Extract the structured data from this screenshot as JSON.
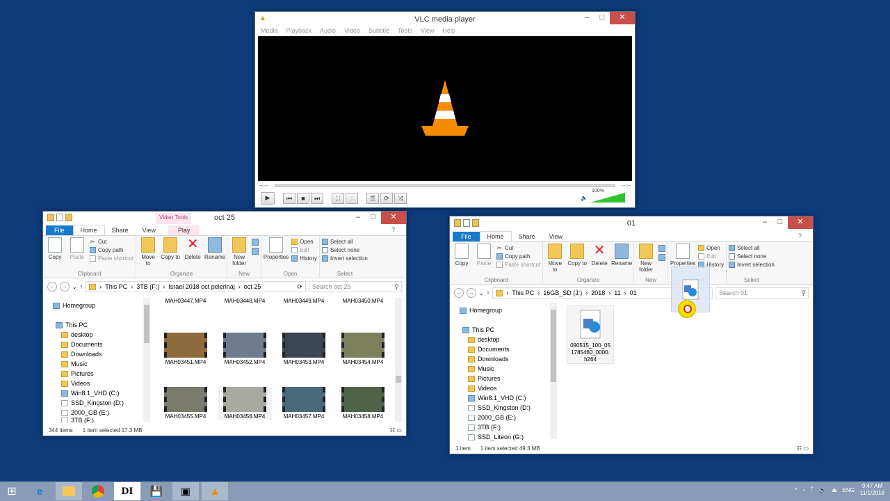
{
  "vlc": {
    "title": "VLC media player",
    "menu": [
      "Media",
      "Playback",
      "Audio",
      "Video",
      "Subtitle",
      "Tools",
      "View",
      "Help"
    ],
    "time_elapsed": "--:--",
    "time_total": "--:--",
    "volume": "100%",
    "volume_level": 1.0
  },
  "win_left": {
    "title": "oct 25",
    "context_tab": "Video Tools",
    "tabs": [
      "File",
      "Home",
      "Share",
      "View",
      "Play"
    ],
    "path": [
      "This PC",
      "3TB (F:)",
      "Israel 2018 oct pelerinaj",
      "oct 25"
    ],
    "search_placeholder": "Search oct 25",
    "status_count": "344 items",
    "status_selected": "1 item selected  17.3 MB",
    "nav": [
      "Homegroup",
      "This PC",
      "desktop",
      "Documents",
      "Downloads",
      "Music",
      "Pictures",
      "Videos",
      "Win8.1_VHD (C:)",
      "SSD_Kingston (D:)",
      "2000_GB (E:)",
      "3TB (F:)"
    ],
    "files": [
      "MAH03447.MP4",
      "MAH03448.MP4",
      "MAH03449.MP4",
      "MAH03450.MP4",
      "MAH03451.MP4",
      "MAH03452.MP4",
      "MAH03453.MP4",
      "MAH03454.MP4",
      "MAH03455.MP4",
      "MAH03456.MP4",
      "MAH03457.MP4",
      "MAH03458.MP4"
    ]
  },
  "win_right": {
    "title": "01",
    "tabs": [
      "File",
      "Home",
      "Share",
      "View"
    ],
    "path": [
      "This PC",
      "16GB_SD (J:)",
      "2018",
      "11",
      "01"
    ],
    "search_placeholder": "Search 01",
    "status_count": "1 item",
    "status_selected": "1 item selected  49.3 MB",
    "nav": [
      "Homegroup",
      "This PC",
      "desktop",
      "Documents",
      "Downloads",
      "Music",
      "Pictures",
      "Videos",
      "Win8.1_VHD (C:)",
      "SSD_Kingston (D:)",
      "2000_GB (E:)",
      "3TB (F:)",
      "SSD_Liteon (G:)"
    ],
    "file_name": "090515_100_051785460_0000.h264"
  },
  "ribbon": {
    "clipboard": {
      "copy": "Copy",
      "paste": "Paste",
      "cut": "Cut",
      "copy_path": "Copy path",
      "paste_shortcut": "Paste shortcut",
      "label": "Clipboard"
    },
    "organize": {
      "move_to": "Move to",
      "copy_to": "Copy to",
      "delete": "Delete",
      "rename": "Rename",
      "label": "Organize"
    },
    "new": {
      "new_folder": "New folder",
      "label": "New"
    },
    "open": {
      "properties": "Properties",
      "open": "Open",
      "edit": "Edit",
      "history": "History",
      "label": "Open"
    },
    "select": {
      "select_all": "Select all",
      "select_none": "Select none",
      "invert": "Invert selection",
      "label": "Select"
    }
  },
  "taskbar": {
    "lang": "ENG",
    "time": "9:47 AM",
    "date": "11/1/2018"
  }
}
